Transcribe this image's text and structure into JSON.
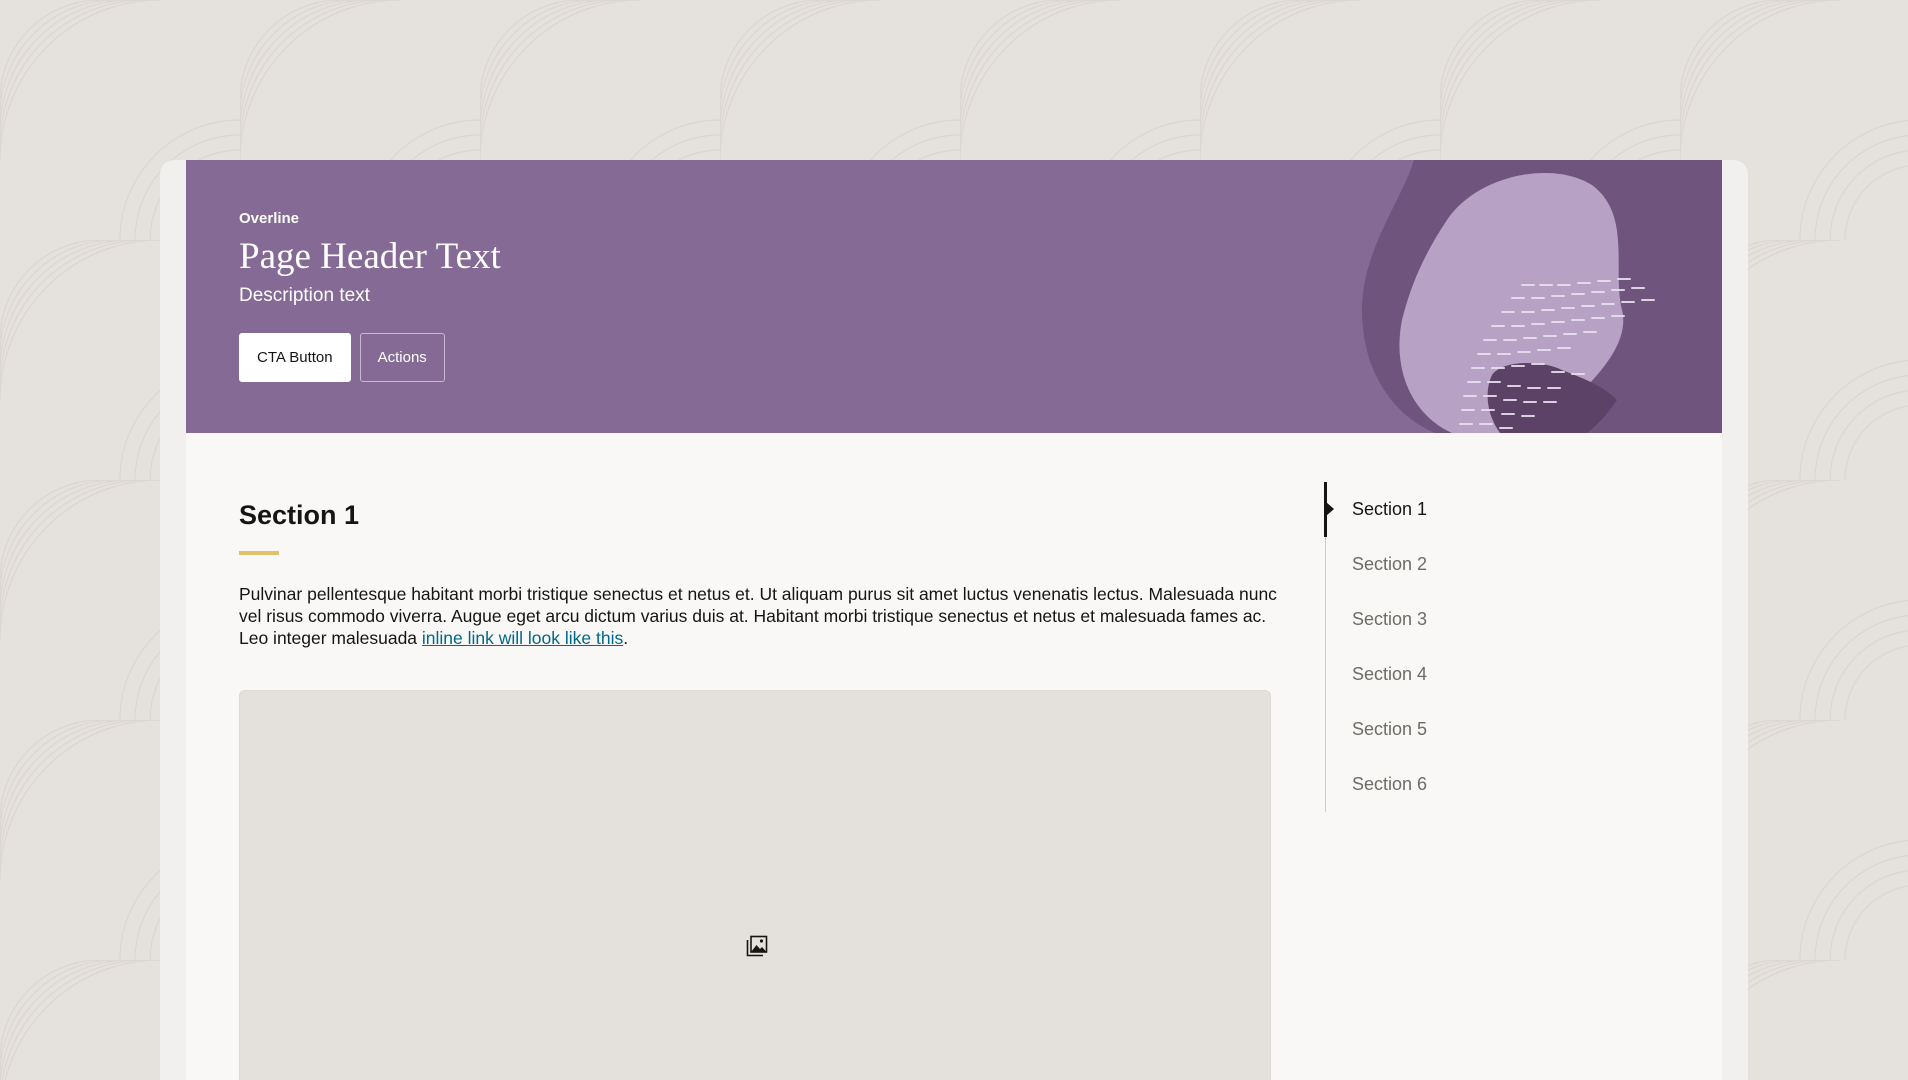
{
  "header": {
    "overline": "Overline",
    "title": "Page Header Text",
    "description": "Description text",
    "cta_label": "CTA Button",
    "actions_label": "Actions"
  },
  "section": {
    "title": "Section 1",
    "body": "Pulvinar pellentesque habitant morbi tristique senectus et netus et. Ut aliquam purus sit amet luctus venenatis lectus. Malesuada nunc vel risus commodo viverra. Augue eget arcu dictum varius duis at. Habitant morbi tristique senectus et netus et malesuada fames ac. Leo integer malesuada ",
    "link_text": "inline link will look like this",
    "body_end": "."
  },
  "image": {
    "icon": "image-icon"
  },
  "toc": {
    "active_index": 0,
    "items": [
      {
        "label": "Section 1"
      },
      {
        "label": "Section 2"
      },
      {
        "label": "Section 3"
      },
      {
        "label": "Section 4"
      },
      {
        "label": "Section 5"
      },
      {
        "label": "Section 6"
      }
    ]
  },
  "colors": {
    "page_background": "#e5e1dc",
    "header_purple": "#846a94",
    "accent_underline": "#e0c26c",
    "link": "#00688c",
    "text": "#161513",
    "muted_text": "#6f6b66"
  }
}
